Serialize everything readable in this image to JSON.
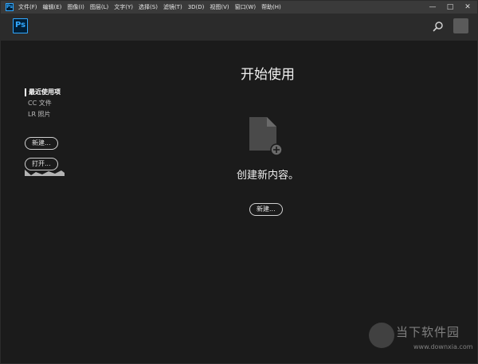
{
  "app": {
    "mini_icon": "Ps",
    "logo_text": "Ps"
  },
  "menubar": {
    "items": [
      "文件(F)",
      "编辑(E)",
      "图像(I)",
      "图层(L)",
      "文字(Y)",
      "选择(S)",
      "滤镜(T)",
      "3D(D)",
      "视图(V)",
      "窗口(W)",
      "帮助(H)"
    ],
    "controls": {
      "minimize": "—",
      "maximize": "□",
      "close": "✕"
    }
  },
  "header": {
    "search_icon": "search-icon",
    "avatar_icon": "avatar"
  },
  "sidebar": {
    "items": [
      {
        "label": "最近使用项",
        "active": true
      },
      {
        "label": "CC 文件",
        "active": false
      },
      {
        "label": "LR 照片",
        "active": false
      }
    ],
    "new_button": "新建...",
    "open_button": "打开..."
  },
  "main": {
    "title": "开始使用",
    "create_text": "创建新内容。",
    "new_button": "新建...",
    "doc_icon": "new-document-icon"
  },
  "watermark": {
    "title": "当下软件园",
    "url": "www.downxia.com"
  },
  "colors": {
    "accent": "#31a8ff",
    "background": "#1b1b1b",
    "header": "#2b2b2b",
    "menubar": "#3a3a3a"
  }
}
